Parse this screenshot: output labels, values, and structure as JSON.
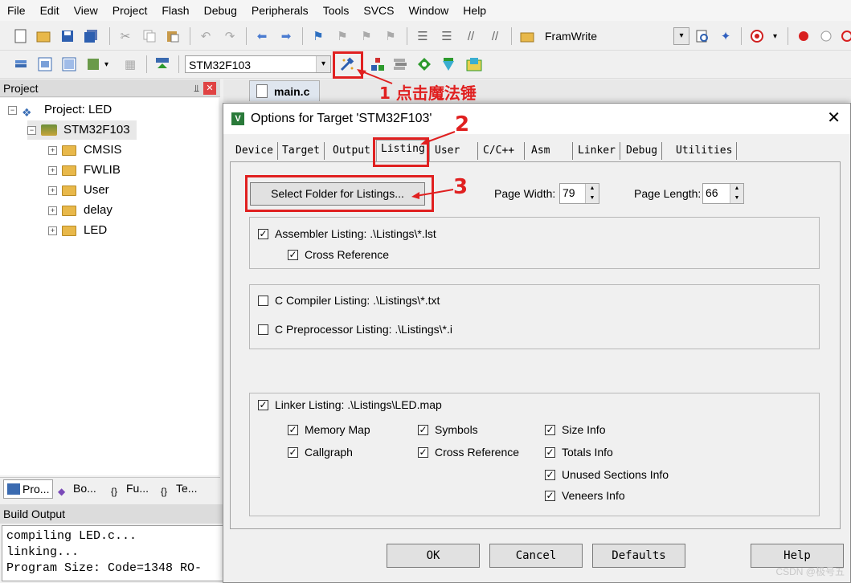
{
  "menu": [
    "File",
    "Edit",
    "View",
    "Project",
    "Flash",
    "Debug",
    "Peripherals",
    "Tools",
    "SVCS",
    "Window",
    "Help"
  ],
  "toolbar": {
    "target_combo": "STM32F103",
    "framwrite_label": "FramWrite",
    "icons": [
      "new-file-icon",
      "open-icon",
      "save-icon",
      "save-all-icon",
      "cut-icon",
      "copy-icon",
      "paste-icon",
      "undo-icon",
      "redo-icon",
      "back-icon",
      "forward-icon",
      "bookmark-icon",
      "indent-icon",
      "outdent-icon",
      "find-icon",
      "debug-icon",
      "breakpoint-icon",
      "options-for-target-icon",
      "manage-icon",
      "pack-icon",
      "select-software-icon"
    ]
  },
  "project_panel": {
    "title": "Project",
    "pin_glyph": "⫫",
    "close_glyph": "✕",
    "tree": {
      "root": "Project: LED",
      "target": "STM32F103",
      "groups": [
        "CMSIS",
        "FWLIB",
        "User",
        "delay",
        "LED"
      ]
    },
    "tabs": [
      "Pro...",
      "Bo...",
      "Fu...",
      "Te..."
    ]
  },
  "build_output": {
    "title": "Build Output",
    "lines": [
      "compiling LED.c...",
      "linking...",
      "Program Size: Code=1348 RO-"
    ]
  },
  "editor": {
    "tab": "main.c"
  },
  "dialog": {
    "title": "Options for Target 'STM32F103'",
    "close_glyph": "✕",
    "tabs": [
      "Device",
      "Target",
      "Output",
      "Listing",
      "User",
      "C/C++",
      "Asm",
      "Linker",
      "Debug",
      "Utilities"
    ],
    "active_tab": "Listing",
    "select_folder_button": "Select Folder for Listings...",
    "page_width_label": "Page Width:",
    "page_width": "79",
    "page_length_label": "Page Length:",
    "page_length": "66",
    "assembler_listing": "Assembler Listing:  .\\Listings\\*.lst",
    "cross_reference": "Cross Reference",
    "c_compiler_listing": "C Compiler Listing:  .\\Listings\\*.txt",
    "c_preprocessor_listing": "C Preprocessor Listing:  .\\Listings\\*.i",
    "linker_listing": "Linker Listing:  .\\Listings\\LED.map",
    "linker_options": {
      "memory_map": "Memory Map",
      "callgraph": "Callgraph",
      "symbols": "Symbols",
      "cross_reference": "Cross Reference",
      "size_info": "Size Info",
      "totals_info": "Totals Info",
      "unused_sections_info": "Unused Sections Info",
      "veneers_info": "Veneers Info"
    },
    "buttons": {
      "ok": "OK",
      "cancel": "Cancel",
      "defaults": "Defaults",
      "help": "Help"
    }
  },
  "annotations": {
    "step1": "1 点击魔法锤",
    "step2": "2",
    "step3": "3",
    "color": "#e02020"
  },
  "watermark": "CSDN @极号五"
}
